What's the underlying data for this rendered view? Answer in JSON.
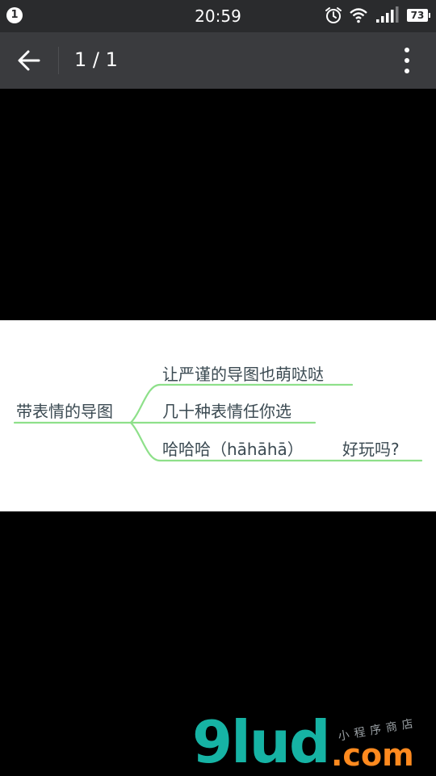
{
  "status_bar": {
    "notification_count": "1",
    "time": "20:59",
    "battery_level": "73",
    "icons": [
      "alarm-clock-icon",
      "wifi-icon",
      "signal-icon",
      "battery-icon"
    ]
  },
  "app_bar": {
    "back_icon": "arrow-left-icon",
    "page_counter": "1 / 1",
    "more_icon": "more-vertical-icon"
  },
  "mind_map": {
    "root": "带表情的导图",
    "branches": [
      "让严谨的导图也萌哒哒",
      "几十种表情任你选",
      "哈哈哈（hāhāhā）"
    ],
    "sub_branch": "好玩吗?",
    "line_color": "#8ee08a"
  },
  "watermark": {
    "main": "9lud",
    "domain": ".com",
    "tagline": "小程序商店"
  },
  "colors": {
    "status_bar_bg": "#2a2b2d",
    "app_bar_bg": "#3a3b3e",
    "viewer_bg": "#000000",
    "watermark_teal": "#16b3a4",
    "watermark_orange": "#ff8a1f"
  }
}
